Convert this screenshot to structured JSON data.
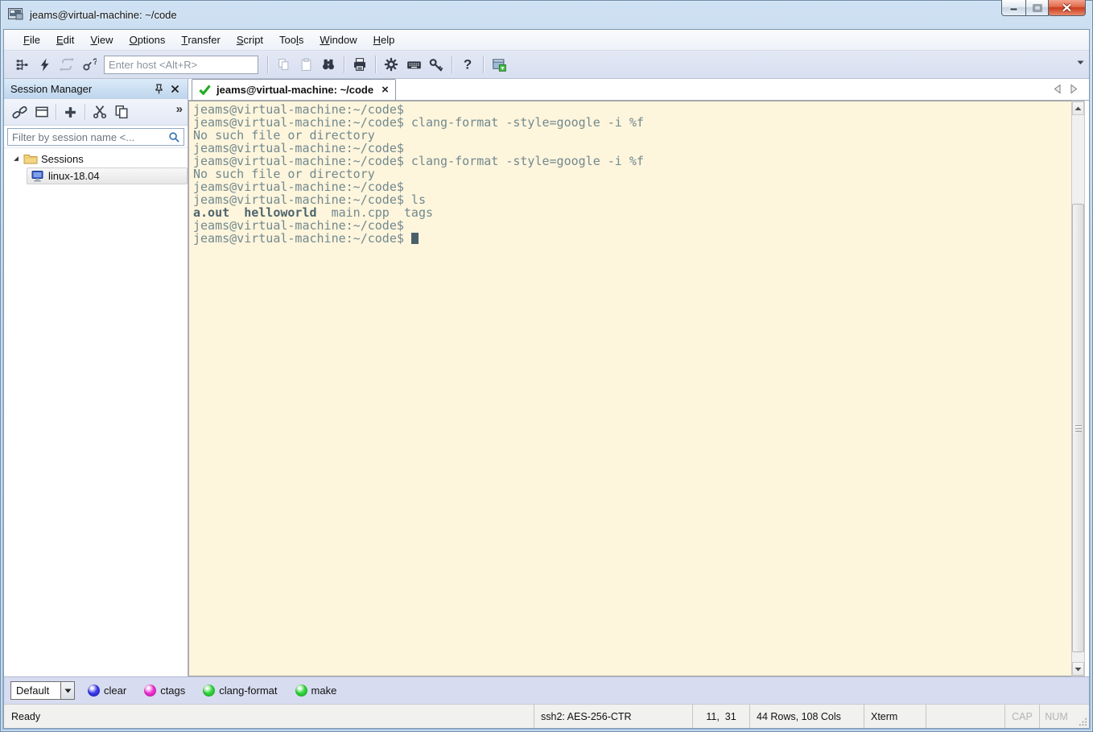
{
  "window": {
    "title": "jeams@virtual-machine: ~/code"
  },
  "titlebar": {
    "buttons": [
      "minimize",
      "maximize",
      "close"
    ]
  },
  "menubar": {
    "items": [
      {
        "pre": "",
        "key": "F",
        "post": "ile"
      },
      {
        "pre": "",
        "key": "E",
        "post": "dit"
      },
      {
        "pre": "",
        "key": "V",
        "post": "iew"
      },
      {
        "pre": "",
        "key": "O",
        "post": "ptions"
      },
      {
        "pre": "",
        "key": "T",
        "post": "ransfer"
      },
      {
        "pre": "",
        "key": "S",
        "post": "cript"
      },
      {
        "pre": "Too",
        "key": "l",
        "post": "s"
      },
      {
        "pre": "",
        "key": "W",
        "post": "indow"
      },
      {
        "pre": "",
        "key": "H",
        "post": "elp"
      }
    ]
  },
  "toolbar": {
    "host_placeholder": "Enter host <Alt+R>",
    "icons": [
      "session-manager-toggle-icon",
      "quick-connect-icon",
      "reconnect-icon",
      "connect-dialog-icon",
      "copy-icon",
      "paste-icon",
      "find-icon",
      "print-icon",
      "options-gear-icon",
      "keyboard-icon",
      "key-icon",
      "help-icon",
      "session-options-icon",
      "toolbar-overflow-icon"
    ],
    "disabled_icons": [
      "reconnect-icon",
      "copy-icon",
      "paste-icon"
    ]
  },
  "session_manager": {
    "title": "Session Manager",
    "header_icons": [
      "pin-icon",
      "close-icon"
    ],
    "tool_icons": [
      "connect-session-icon",
      "new-window-icon",
      "add-session-icon",
      "cut-icon",
      "copy-session-icon",
      "overflow-chevron-icon"
    ],
    "overflow_glyph": "»",
    "filter_placeholder": "Filter by session name <...",
    "tree": {
      "root": "Sessions",
      "sessions": [
        "linux-18.04"
      ]
    }
  },
  "tabbar": {
    "tabs": [
      {
        "label": "jeams@virtual-machine: ~/code",
        "status": "connected",
        "close_glyph": "×"
      }
    ]
  },
  "terminal": {
    "colors": {
      "background": "#fdf5dc",
      "text": "#72898f",
      "bold_text": "#4e656e",
      "cursor": "#4a6069"
    },
    "lines": [
      {
        "segs": [
          {
            "t": "jeams@virtual-machine:~/code$"
          }
        ]
      },
      {
        "segs": [
          {
            "t": "jeams@virtual-machine:~/code$ clang-format -style=google -i %f"
          }
        ]
      },
      {
        "segs": [
          {
            "t": "No such file or directory"
          }
        ]
      },
      {
        "segs": [
          {
            "t": "jeams@virtual-machine:~/code$"
          }
        ]
      },
      {
        "segs": [
          {
            "t": "jeams@virtual-machine:~/code$ clang-format -style=google -i %f"
          }
        ]
      },
      {
        "segs": [
          {
            "t": "No such file or directory"
          }
        ]
      },
      {
        "segs": [
          {
            "t": "jeams@virtual-machine:~/code$"
          }
        ]
      },
      {
        "segs": [
          {
            "t": "jeams@virtual-machine:~/code$ ls"
          }
        ]
      },
      {
        "segs": [
          {
            "t": "a.out",
            "b": true
          },
          {
            "t": "  "
          },
          {
            "t": "helloworld",
            "b": true
          },
          {
            "t": "  main.cpp  tags"
          }
        ]
      },
      {
        "segs": [
          {
            "t": "jeams@virtual-machine:~/code$"
          }
        ]
      },
      {
        "segs": [
          {
            "t": "jeams@virtual-machine:~/code$ "
          }
        ],
        "cursor": true
      }
    ]
  },
  "buttonbar": {
    "profile": "Default",
    "buttons": [
      {
        "label": "clear",
        "color": "#4040f0",
        "dark": "#1414a8"
      },
      {
        "label": "ctags",
        "color": "#f435d6",
        "dark": "#aa1292"
      },
      {
        "label": "clang-format",
        "color": "#35d93f",
        "dark": "#149a1e"
      },
      {
        "label": "make",
        "color": "#35d93f",
        "dark": "#149a1e"
      }
    ]
  },
  "statusbar": {
    "ready": "Ready",
    "encryption": "ssh2: AES-256-CTR",
    "cursor_position": "11,  31",
    "terminal_size": "44 Rows, 108 Cols",
    "emulation": "Xterm",
    "caps": "CAP",
    "num": "NUM"
  }
}
